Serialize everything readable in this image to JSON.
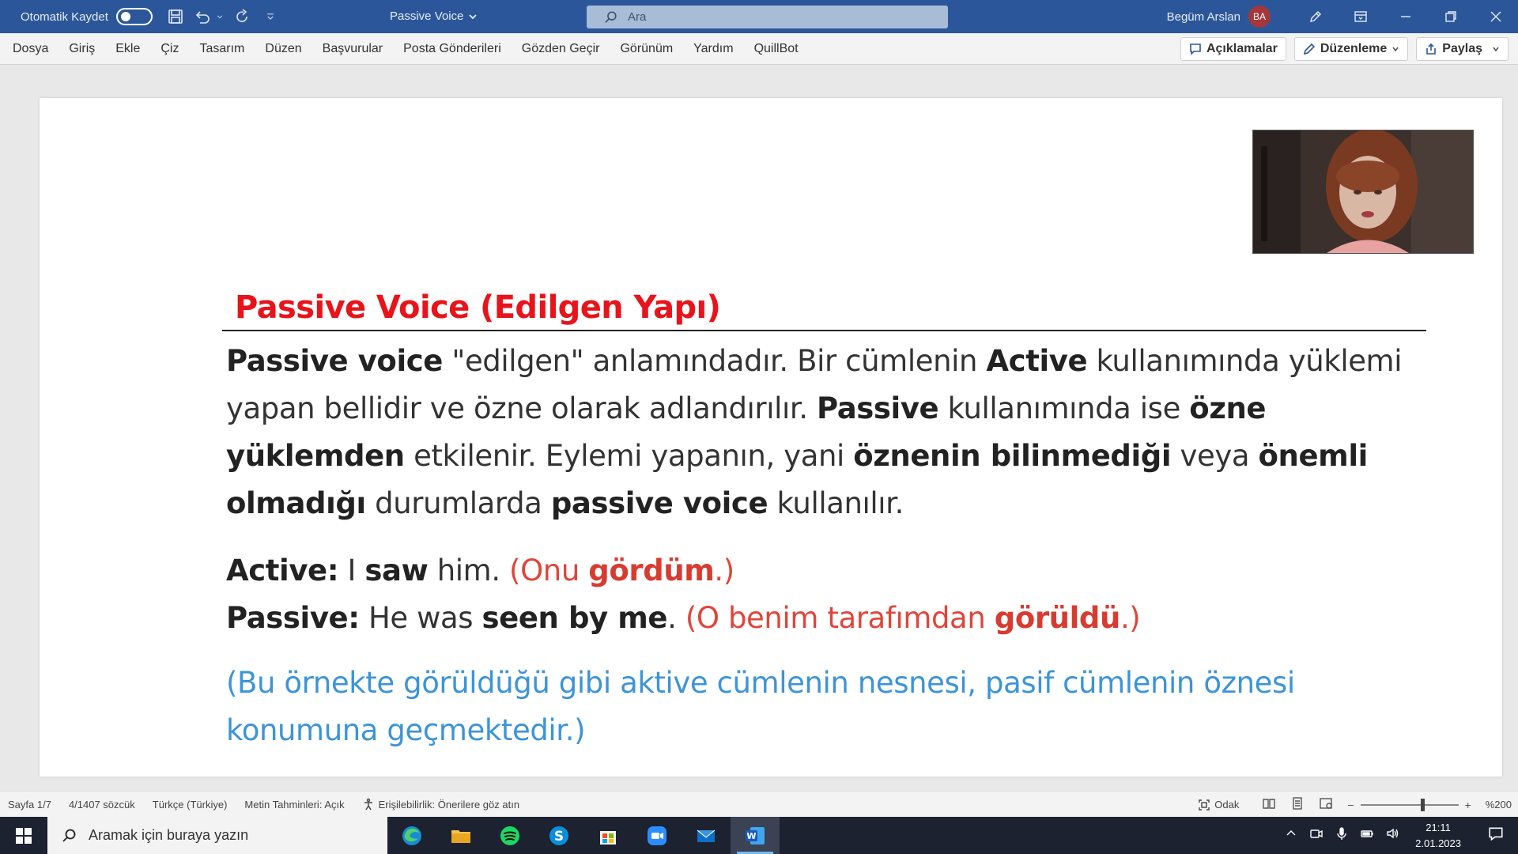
{
  "titlebar": {
    "autosave_label": "Otomatik Kaydet",
    "doc_title": "Passive Voice",
    "search_placeholder": "Ara",
    "user_name": "Begüm Arslan",
    "user_initials": "BA"
  },
  "menu": {
    "items": [
      "Dosya",
      "Giriş",
      "Ekle",
      "Çiz",
      "Tasarım",
      "Düzen",
      "Başvurular",
      "Posta Gönderileri",
      "Gözden Geçir",
      "Görünüm",
      "Yardım",
      "QuillBot"
    ],
    "comments_label": "Açıklamalar",
    "editing_label": "Düzenleme",
    "share_label": "Paylaş"
  },
  "document": {
    "heading": "Passive Voice (Edilgen Yapı)",
    "p1": {
      "s1": "Passive voice",
      "s2": " \"edilgen\" anlamındadır. Bir cümlenin ",
      "s3": "Active",
      "s4": " kullanımında yüklemi yapan bellidir ve özne olarak adlandırılır. ",
      "s5": "Passive",
      "s6": " kullanımında ise ",
      "s7": "özne yüklemden",
      "s8": " etkilenir. Eylemi yapanın, yani ",
      "s9": "öznenin bilinmediği",
      "s10": " veya ",
      "s11": "önemli olmadığı",
      "s12": " durumlarda ",
      "s13": "passive voice",
      "s14": " kullanılır."
    },
    "active": {
      "label": "Active:",
      "s1": " I ",
      "s2": "saw",
      "s3": " him. ",
      "t1": "(Onu ",
      "t2": "gördüm",
      "t3": ".)"
    },
    "passive": {
      "label": "Passive:",
      "s1": " He was ",
      "s2": "seen by me",
      "s3": ". ",
      "t1": "(O benim tarafımdan ",
      "t2": "görüldü",
      "t3": ".)"
    },
    "note": "(Bu örnekte görüldüğü gibi aktive cümlenin nesnesi, pasif cümlenin öznesi konumuna geçmektedir.)"
  },
  "statusbar": {
    "page": "Sayfa 1/7",
    "words": "4/1407 sözcük",
    "language": "Türkçe (Türkiye)",
    "predictions": "Metin Tahminleri: Açık",
    "accessibility": "Erişilebilirlik: Önerilere göz atın",
    "focus": "Odak",
    "zoom": "%200",
    "zoom_fraction": 0.62
  },
  "taskbar": {
    "search_placeholder": "Aramak için buraya yazın",
    "time": "21:11",
    "date": "2.01.2023",
    "apps": [
      "edge-icon",
      "file-explorer-icon",
      "spotify-icon",
      "skype-icon",
      "store-icon",
      "zoom-icon",
      "mail-icon",
      "word-icon"
    ]
  },
  "colors": {
    "titlebar": "#2b579a",
    "heading": "#e8141b",
    "translation": "#e0453a",
    "note": "#3d94d6"
  }
}
